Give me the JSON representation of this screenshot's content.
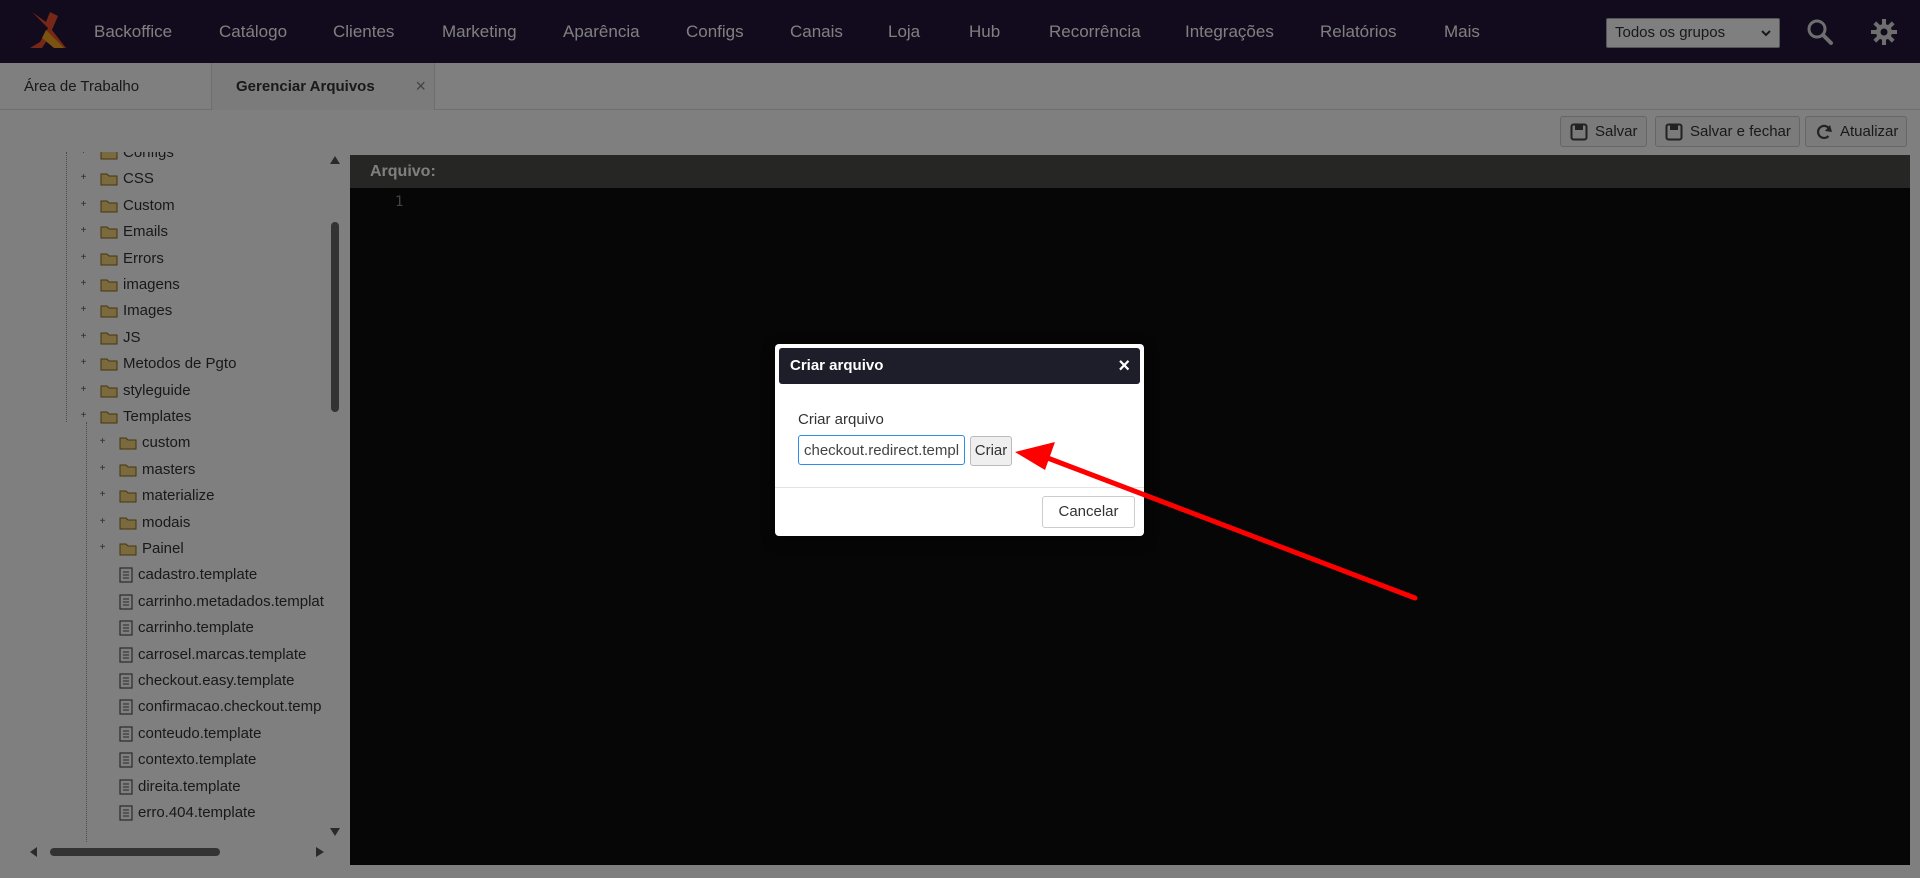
{
  "nav": {
    "items": [
      "Backoffice",
      "Catálogo",
      "Clientes",
      "Marketing",
      "Aparência",
      "Configs",
      "Canais",
      "Loja",
      "Hub",
      "Recorrência",
      "Integrações",
      "Relatórios",
      "Mais"
    ],
    "group_select": "Todos os grupos"
  },
  "tabs": [
    {
      "label": "Área de Trabalho"
    },
    {
      "label": "Gerenciar Arquivos",
      "close": "×"
    }
  ],
  "toolbar": {
    "save": "Salvar",
    "save_close": "Salvar e fechar",
    "refresh": "Atualizar"
  },
  "tree": {
    "folders": [
      "Configs",
      "CSS",
      "Custom",
      "Emails",
      "Errors",
      "imagens",
      "Images",
      "JS",
      "Metodos de Pgto",
      "styleguide",
      "Templates"
    ],
    "subfolders": [
      "custom",
      "masters",
      "materialize",
      "modais",
      "Painel"
    ],
    "files": [
      "cadastro.template",
      "carrinho.metadados.templat",
      "carrinho.template",
      "carrosel.marcas.template",
      "checkout.easy.template",
      "confirmacao.checkout.temp",
      "conteudo.template",
      "contexto.template",
      "direita.template",
      "erro.404.template"
    ]
  },
  "editor": {
    "header": "Arquivo:",
    "line_number": "1"
  },
  "modal": {
    "title": "Criar arquivo",
    "close": "×",
    "label": "Criar arquivo",
    "input_value": "checkout.redirect.template",
    "create_button": "Criar",
    "cancel_button": "Cancelar"
  },
  "colors": {
    "nav_bg": "#24143a",
    "editor_bg": "#0d0d0d",
    "arrow": "#ff0000",
    "input_border": "#2e8de6"
  }
}
